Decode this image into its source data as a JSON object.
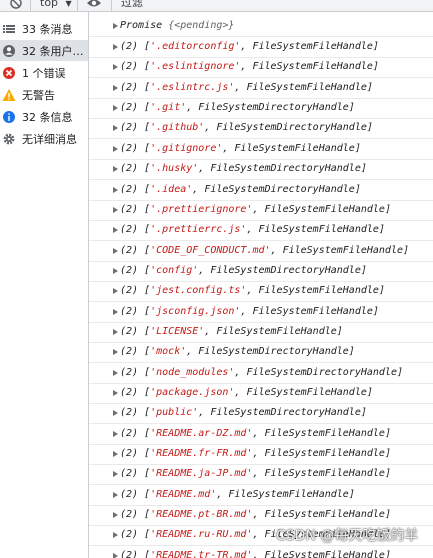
{
  "toolbar": {
    "levels_label": "top",
    "filter_placeholder": "过滤"
  },
  "sidebar": {
    "items": [
      {
        "label": "33 条消息",
        "icon": "list-icon",
        "selected": false
      },
      {
        "label": "32 条用户消…",
        "icon": "user-icon",
        "selected": true
      },
      {
        "label": "1 个错误",
        "icon": "error-icon",
        "selected": false
      },
      {
        "label": "无警告",
        "icon": "warning-icon",
        "selected": false
      },
      {
        "label": "32 条信息",
        "icon": "info-icon",
        "selected": false
      },
      {
        "label": "无详细消息",
        "icon": "gear-icon",
        "selected": false
      }
    ]
  },
  "console": {
    "promise": {
      "label": "Promise",
      "state": "{<pending>}"
    },
    "entries": [
      {
        "count": "(2)",
        "name": "'.editorconfig'",
        "type": "FileSystemFileHandle"
      },
      {
        "count": "(2)",
        "name": "'.eslintignore'",
        "type": "FileSystemFileHandle"
      },
      {
        "count": "(2)",
        "name": "'.eslintrc.js'",
        "type": "FileSystemFileHandle"
      },
      {
        "count": "(2)",
        "name": "'.git'",
        "type": "FileSystemDirectoryHandle"
      },
      {
        "count": "(2)",
        "name": "'.github'",
        "type": "FileSystemDirectoryHandle"
      },
      {
        "count": "(2)",
        "name": "'.gitignore'",
        "type": "FileSystemFileHandle"
      },
      {
        "count": "(2)",
        "name": "'.husky'",
        "type": "FileSystemDirectoryHandle"
      },
      {
        "count": "(2)",
        "name": "'.idea'",
        "type": "FileSystemDirectoryHandle"
      },
      {
        "count": "(2)",
        "name": "'.prettierignore'",
        "type": "FileSystemFileHandle"
      },
      {
        "count": "(2)",
        "name": "'.prettierrc.js'",
        "type": "FileSystemFileHandle"
      },
      {
        "count": "(2)",
        "name": "'CODE_OF_CONDUCT.md'",
        "type": "FileSystemFileHandle"
      },
      {
        "count": "(2)",
        "name": "'config'",
        "type": "FileSystemDirectoryHandle"
      },
      {
        "count": "(2)",
        "name": "'jest.config.ts'",
        "type": "FileSystemFileHandle"
      },
      {
        "count": "(2)",
        "name": "'jsconfig.json'",
        "type": "FileSystemFileHandle"
      },
      {
        "count": "(2)",
        "name": "'LICENSE'",
        "type": "FileSystemFileHandle"
      },
      {
        "count": "(2)",
        "name": "'mock'",
        "type": "FileSystemDirectoryHandle"
      },
      {
        "count": "(2)",
        "name": "'node_modules'",
        "type": "FileSystemDirectoryHandle"
      },
      {
        "count": "(2)",
        "name": "'package.json'",
        "type": "FileSystemFileHandle"
      },
      {
        "count": "(2)",
        "name": "'public'",
        "type": "FileSystemDirectoryHandle"
      },
      {
        "count": "(2)",
        "name": "'README.ar-DZ.md'",
        "type": "FileSystemFileHandle"
      },
      {
        "count": "(2)",
        "name": "'README.fr-FR.md'",
        "type": "FileSystemFileHandle"
      },
      {
        "count": "(2)",
        "name": "'README.ja-JP.md'",
        "type": "FileSystemFileHandle"
      },
      {
        "count": "(2)",
        "name": "'README.md'",
        "type": "FileSystemFileHandle"
      },
      {
        "count": "(2)",
        "name": "'README.pt-BR.md'",
        "type": "FileSystemFileHandle"
      },
      {
        "count": "(2)",
        "name": "'README.ru-RU.md'",
        "type": "FileSystemFileHandle"
      },
      {
        "count": "(2)",
        "name": "'README.tr-TR.md'",
        "type": "FileSystemFileHandle"
      }
    ]
  },
  "watermark": "CSDN @每天吃饭的羊",
  "colors": {
    "string": "#c41a16",
    "selected_bg": "#dee1e6",
    "error": "#d93025",
    "warning": "#f9ab00",
    "info": "#1a73e8"
  }
}
